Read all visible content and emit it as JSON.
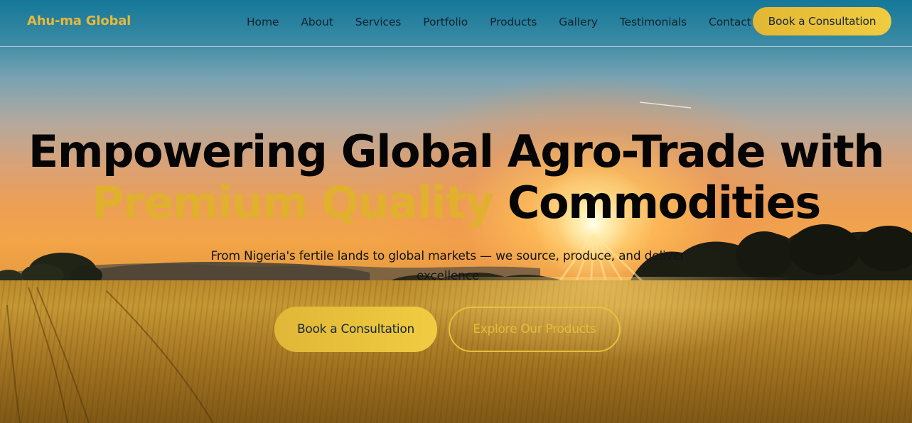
{
  "brand": {
    "name": "Ahu-ma Global"
  },
  "nav": {
    "items": [
      {
        "label": "Home"
      },
      {
        "label": "About"
      },
      {
        "label": "Services"
      },
      {
        "label": "Portfolio"
      },
      {
        "label": "Products"
      },
      {
        "label": "Gallery"
      },
      {
        "label": "Testimonials"
      },
      {
        "label": "Contact"
      }
    ],
    "cta_label": "Book a Consultation"
  },
  "hero": {
    "title_line1": "Empowering Global Agro-Trade with",
    "title_accent": "Premium Quality",
    "title_line2_end": "Commodities",
    "subtitle": "From Nigeria's fertile lands to global markets — we source, produce, and deliver excellence",
    "primary_button": "Book a Consultation",
    "secondary_button": "Explore Our Products"
  },
  "colors": {
    "accent_gold": "#e0b02e",
    "button_gold": "#f0cc40",
    "heading_text": "#050505",
    "nav_text": "#10222c"
  }
}
